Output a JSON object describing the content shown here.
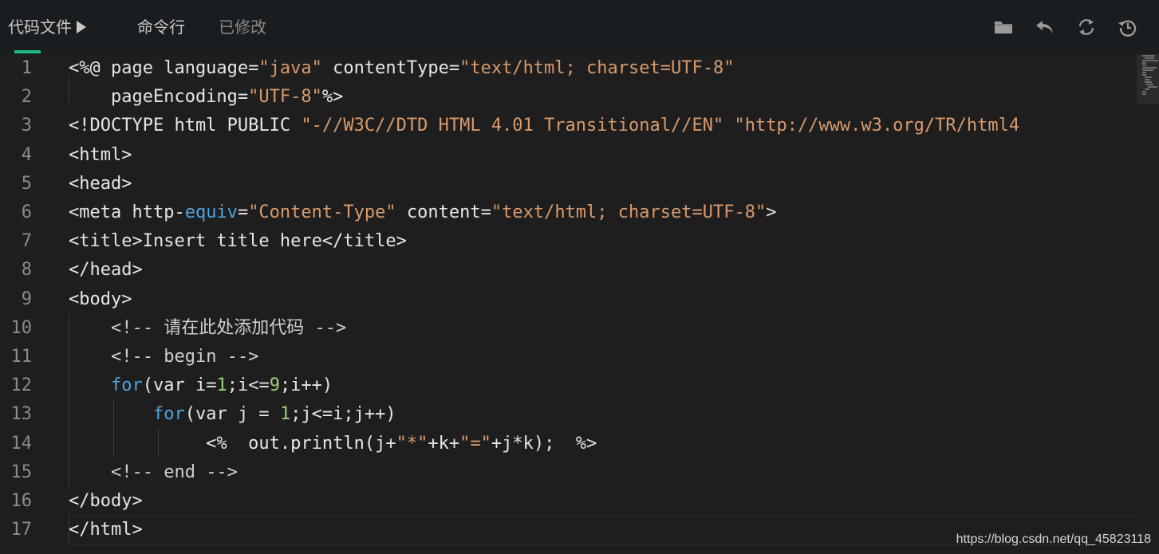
{
  "toolbar": {
    "tabs": [
      {
        "label": "代码文件"
      },
      {
        "label": "命令行"
      },
      {
        "label": "已修改"
      }
    ],
    "actions": [
      {
        "name": "folder",
        "icon": "folder-icon"
      },
      {
        "name": "undo",
        "icon": "undo-icon"
      },
      {
        "name": "refresh",
        "icon": "refresh-icon"
      },
      {
        "name": "history",
        "icon": "history-icon"
      }
    ],
    "accent_color": "#1fb87f"
  },
  "editor": {
    "line_numbers": [
      "1",
      "2",
      "3",
      "4",
      "5",
      "6",
      "7",
      "8",
      "9",
      "10",
      "11",
      "12",
      "13",
      "14",
      "15",
      "16",
      "17"
    ],
    "lines": [
      [
        {
          "t": "<%@ page language="
        },
        {
          "t": "\"java\"",
          "c": "str"
        },
        {
          "t": " contentType="
        },
        {
          "t": "\"text/html; charset=UTF-8\"",
          "c": "str"
        }
      ],
      [
        {
          "t": "    pageEncoding="
        },
        {
          "t": "\"UTF-8\"",
          "c": "str"
        },
        {
          "t": "%>"
        }
      ],
      [
        {
          "t": "<!DOCTYPE html PUBLIC "
        },
        {
          "t": "\"-//W3C//DTD HTML 4.01 Transitional//EN\"",
          "c": "str"
        },
        {
          "t": " "
        },
        {
          "t": "\"http://www.w3.org/TR/html4",
          "c": "str"
        }
      ],
      [
        {
          "t": "<html>"
        }
      ],
      [
        {
          "t": "<head>"
        }
      ],
      [
        {
          "t": "<meta http-"
        },
        {
          "t": "equiv",
          "c": "kw"
        },
        {
          "t": "="
        },
        {
          "t": "\"Content-Type\"",
          "c": "str"
        },
        {
          "t": " content="
        },
        {
          "t": "\"text/html; charset=UTF-8\"",
          "c": "str"
        },
        {
          "t": ">"
        }
      ],
      [
        {
          "t": "<title>Insert title here</title>"
        }
      ],
      [
        {
          "t": "</head>"
        }
      ],
      [
        {
          "t": "<body>"
        }
      ],
      [
        {
          "t": "    "
        },
        {
          "t": "<!-- 请在此处添加代码 -->",
          "c": "cm"
        }
      ],
      [
        {
          "t": "    "
        },
        {
          "t": "<!-- begin -->",
          "c": "cm"
        }
      ],
      [
        {
          "t": "    "
        },
        {
          "t": "for",
          "c": "kw"
        },
        {
          "t": "(var i="
        },
        {
          "t": "1",
          "c": "num"
        },
        {
          "t": ";i<="
        },
        {
          "t": "9",
          "c": "num"
        },
        {
          "t": ";i++)"
        }
      ],
      [
        {
          "t": "        "
        },
        {
          "t": "for",
          "c": "kw"
        },
        {
          "t": "(var j = "
        },
        {
          "t": "1",
          "c": "num"
        },
        {
          "t": ";j<=i;j++)"
        }
      ],
      [
        {
          "t": "             <%  out.println(j+"
        },
        {
          "t": "\"*\"",
          "c": "str"
        },
        {
          "t": "+k+"
        },
        {
          "t": "\"=\"",
          "c": "str"
        },
        {
          "t": "+j*k);  %>"
        }
      ],
      [
        {
          "t": "    "
        },
        {
          "t": "<!-- end -->",
          "c": "cm"
        }
      ],
      [
        {
          "t": "</body>"
        }
      ],
      [
        {
          "t": "</html>"
        }
      ]
    ],
    "colors": {
      "background": "#1e1e1e",
      "string": "#d99a6c",
      "keyword": "#4fa3e0",
      "number": "#9ccc7a",
      "text": "#e6e6e6",
      "line_number": "#8b8b8b"
    }
  },
  "watermark": "https://blog.csdn.net/qq_45823118"
}
